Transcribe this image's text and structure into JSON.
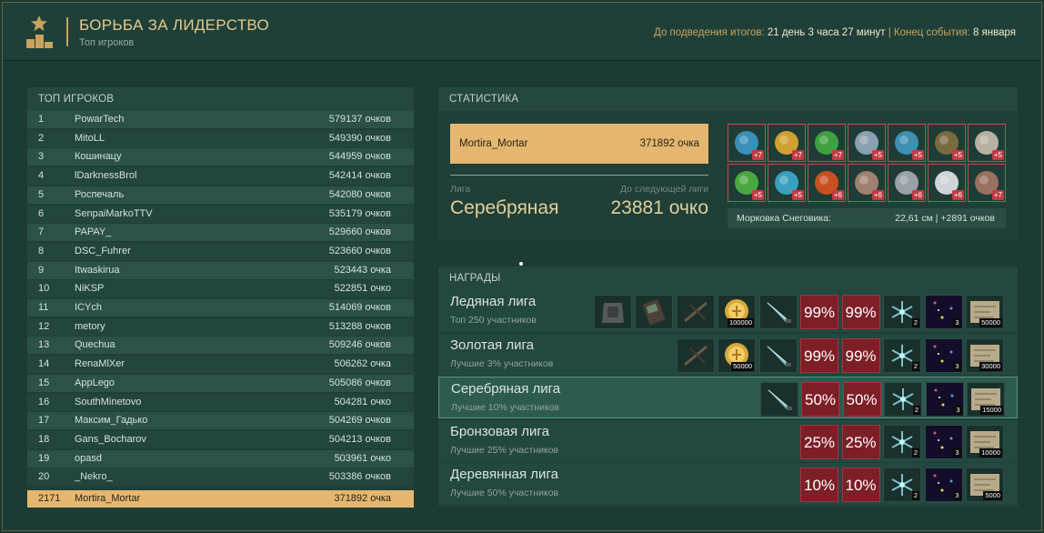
{
  "header": {
    "title": "БОРЬБА ЗА ЛИДЕРСТВО",
    "subtitle": "Топ игроков",
    "timer_label": "До подведения итогов: ",
    "timer_value": "21 день 3 часа 27 минут",
    "sep": " | ",
    "end_label": "Конец события: ",
    "end_value": "8 января"
  },
  "leaderboard": {
    "title": "ТОП ИГРОКОВ",
    "rows": [
      {
        "rank": "1",
        "name": "PowarTech",
        "score": "579137 очков"
      },
      {
        "rank": "2",
        "name": "MitoLL",
        "score": "549390 очков"
      },
      {
        "rank": "3",
        "name": "Кошинацу",
        "score": "544959 очков"
      },
      {
        "rank": "4",
        "name": "lDarknessBrol",
        "score": "542414 очков"
      },
      {
        "rank": "5",
        "name": "Роспечаль",
        "score": "542080 очков"
      },
      {
        "rank": "6",
        "name": "SenpaiMarkoTTV",
        "score": "535179 очков"
      },
      {
        "rank": "7",
        "name": "PAPAY_",
        "score": "529660 очков"
      },
      {
        "rank": "8",
        "name": "DSC_Fuhrer",
        "score": "523660 очков"
      },
      {
        "rank": "9",
        "name": "Itwaskirua",
        "score": "523443 очка"
      },
      {
        "rank": "10",
        "name": "NiKSP",
        "score": "522851 очко"
      },
      {
        "rank": "11",
        "name": "ICYch",
        "score": "514069 очков"
      },
      {
        "rank": "12",
        "name": "metory",
        "score": "513288 очков"
      },
      {
        "rank": "13",
        "name": "Quechua",
        "score": "509246 очков"
      },
      {
        "rank": "14",
        "name": "RenaMlXer",
        "score": "506262 очка"
      },
      {
        "rank": "15",
        "name": "AppLego",
        "score": "505086 очков"
      },
      {
        "rank": "16",
        "name": "SouthMinetovo",
        "score": "504281 очко"
      },
      {
        "rank": "17",
        "name": "Максим_Гадько",
        "score": "504269 очков"
      },
      {
        "rank": "18",
        "name": "Gans_Bocharov",
        "score": "504213 очков"
      },
      {
        "rank": "19",
        "name": "opasd",
        "score": "503961 очко"
      },
      {
        "rank": "20",
        "name": "_Nekro_",
        "score": "503386 очков"
      }
    ],
    "me": {
      "rank": "2171",
      "name": "Mortira_Mortar",
      "score": "371892 очка"
    }
  },
  "stats": {
    "title": "СТАТИСТИКА",
    "name": "Mortira_Mortar",
    "score": "371892 очка",
    "league_label": "Лига",
    "league_value": "Серебряная",
    "next_label": "До следующей лиги",
    "next_value": "23881 очко",
    "items": [
      {
        "icon": "spiky-orb-icon",
        "bonus": "+7",
        "color": "#3a90b8"
      },
      {
        "icon": "torches-icon",
        "bonus": "+7",
        "color": "#d0a030"
      },
      {
        "icon": "green-pods-icon",
        "bonus": "+7",
        "color": "#3fa040"
      },
      {
        "icon": "hook-icon",
        "bonus": "+5",
        "color": "#8aa0b0"
      },
      {
        "icon": "blue-coral-icon",
        "bonus": "+5",
        "color": "#3e8fb0"
      },
      {
        "icon": "mossy-rock-icon",
        "bonus": "+5",
        "color": "#7a6a40"
      },
      {
        "icon": "shell-icon",
        "bonus": "+5",
        "color": "#b8b0a0"
      },
      {
        "icon": "green-vines-icon",
        "bonus": "+5",
        "color": "#4aa840"
      },
      {
        "icon": "blue-crystals-icon",
        "bonus": "+5",
        "color": "#3aa0c0"
      },
      {
        "icon": "orange-chain-icon",
        "bonus": "+6",
        "color": "#c85020"
      },
      {
        "icon": "mushroom-icon",
        "bonus": "+6",
        "color": "#a08070"
      },
      {
        "icon": "ore-rock-icon",
        "bonus": "+6",
        "color": "#9aa0a8"
      },
      {
        "icon": "white-coral-icon",
        "bonus": "+6",
        "color": "#d0d4d8"
      },
      {
        "icon": "crab-claw-icon",
        "bonus": "+7",
        "color": "#9a7060"
      }
    ],
    "carrot_label": "Морковка Снеговика:",
    "carrot_value": "22,61 см | +2891 очков"
  },
  "rewards": {
    "title": "НАГРАДЫ",
    "leagues": [
      {
        "name": "Ледяная лига",
        "desc": "Топ 250 участников",
        "items": [
          {
            "icon": "armor-icon",
            "q": ""
          },
          {
            "icon": "device-icon",
            "q": ""
          },
          {
            "icon": "crossbow-icon",
            "q": ""
          },
          {
            "icon": "coin-icon",
            "q": "100000"
          },
          {
            "icon": "knife-icon",
            "q": ""
          },
          {
            "pct": "99%"
          },
          {
            "pct": "99%"
          },
          {
            "icon": "snowflake-icon",
            "q": "2"
          },
          {
            "icon": "sparkle-icon",
            "q": "3"
          },
          {
            "icon": "map-icon",
            "q": "50000"
          }
        ]
      },
      {
        "name": "Золотая лига",
        "desc": "Лучшие 3% участников",
        "items": [
          {
            "icon": "crossbow-icon",
            "q": ""
          },
          {
            "icon": "coin-icon",
            "q": "50000"
          },
          {
            "icon": "knife-icon",
            "q": ""
          },
          {
            "pct": "99%"
          },
          {
            "pct": "99%"
          },
          {
            "icon": "snowflake-icon",
            "q": "2"
          },
          {
            "icon": "sparkle-icon",
            "q": "3"
          },
          {
            "icon": "map-icon",
            "q": "30000"
          }
        ]
      },
      {
        "name": "Серебряная лига",
        "desc": "Лучшие 10% участников",
        "current": true,
        "items": [
          {
            "icon": "knife-icon",
            "q": ""
          },
          {
            "pct": "50%"
          },
          {
            "pct": "50%"
          },
          {
            "icon": "snowflake-icon",
            "q": "2"
          },
          {
            "icon": "sparkle-icon",
            "q": "3"
          },
          {
            "icon": "map-icon",
            "q": "15000"
          }
        ]
      },
      {
        "name": "Бронзовая лига",
        "desc": "Лучшие 25% участников",
        "items": [
          {
            "pct": "25%"
          },
          {
            "pct": "25%"
          },
          {
            "icon": "snowflake-icon",
            "q": "2"
          },
          {
            "icon": "sparkle-icon",
            "q": "3"
          },
          {
            "icon": "map-icon",
            "q": "10000"
          }
        ]
      },
      {
        "name": "Деревянная лига",
        "desc": "Лучшие 50% участников",
        "items": [
          {
            "pct": "10%"
          },
          {
            "pct": "10%"
          },
          {
            "icon": "snowflake-icon",
            "q": "2"
          },
          {
            "icon": "sparkle-icon",
            "q": "3"
          },
          {
            "icon": "map-icon",
            "q": "5000"
          }
        ]
      }
    ]
  }
}
